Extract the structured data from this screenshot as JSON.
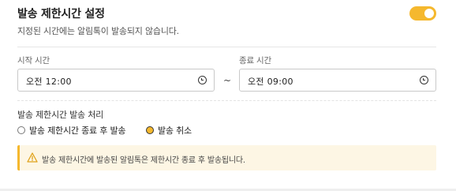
{
  "header": {
    "title": "발송 제한시간 설정",
    "subtitle": "지정된 시간에는 알림톡이 발송되지 않습니다.",
    "toggle_on": true
  },
  "time_range": {
    "start_label": "시작 시간",
    "start_value": "오전 12:00",
    "separator": "~",
    "end_label": "종료 시간",
    "end_value": "오전 09:00"
  },
  "handling": {
    "label": "발송 제한시간 발송 처리",
    "options": [
      {
        "label": "발송 제한시간 종료 후 발송",
        "selected": false
      },
      {
        "label": "발송 취소",
        "selected": true
      }
    ]
  },
  "notice": {
    "text": "발송 제한시간에 발송된 알림톡은 제한시간 종료 후 발송됩니다.",
    "icon": "warning-icon"
  },
  "colors": {
    "accent": "#f5b82e",
    "notice_bg": "#fdf6e4"
  }
}
